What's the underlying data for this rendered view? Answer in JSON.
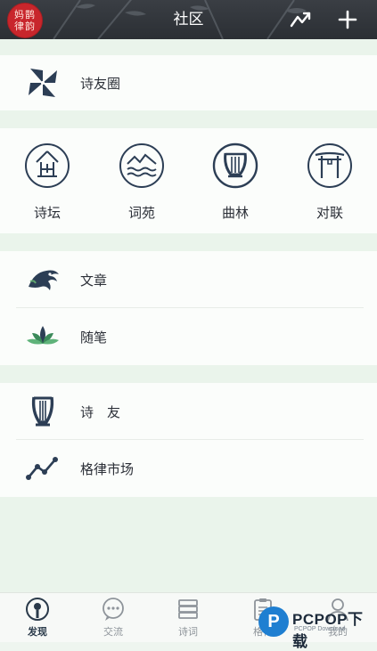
{
  "header": {
    "logo_line1": "妈鹊",
    "logo_line2": "律韵",
    "title": "社区",
    "icons": [
      "trend-icon",
      "plus-icon"
    ]
  },
  "sections": {
    "circle": {
      "label": "诗友圈",
      "icon": "pinwheel-icon"
    },
    "grid": [
      {
        "label": "诗坛",
        "icon": "altar-icon"
      },
      {
        "label": "词苑",
        "icon": "mountain-wave-icon"
      },
      {
        "label": "曲林",
        "icon": "lyre-icon"
      },
      {
        "label": "对联",
        "icon": "archway-icon"
      }
    ],
    "reading": [
      {
        "label": "文章",
        "icon": "dragon-icon"
      },
      {
        "label": "随笔",
        "icon": "lotus-icon"
      }
    ],
    "social": [
      {
        "label": "诗　友",
        "icon": "lyre-icon"
      },
      {
        "label": "格律市场",
        "icon": "line-chart-icon"
      }
    ]
  },
  "tabbar": [
    {
      "label": "发现",
      "icon": "compass-icon",
      "active": true
    },
    {
      "label": "交流",
      "icon": "chat-icon",
      "active": false
    },
    {
      "label": "诗词",
      "icon": "book-icon",
      "active": false
    },
    {
      "label": "格律",
      "icon": "clipboard-icon",
      "active": false
    },
    {
      "label": "我的",
      "icon": "user-icon",
      "active": false
    }
  ],
  "watermark": {
    "brand": "PCPOP下载",
    "sub": "PCPOP Download"
  },
  "colors": {
    "header": "#2b2f34",
    "accent_red": "#c8262c",
    "icon_navy": "#2c3e55",
    "band": "#eaf4eb"
  }
}
